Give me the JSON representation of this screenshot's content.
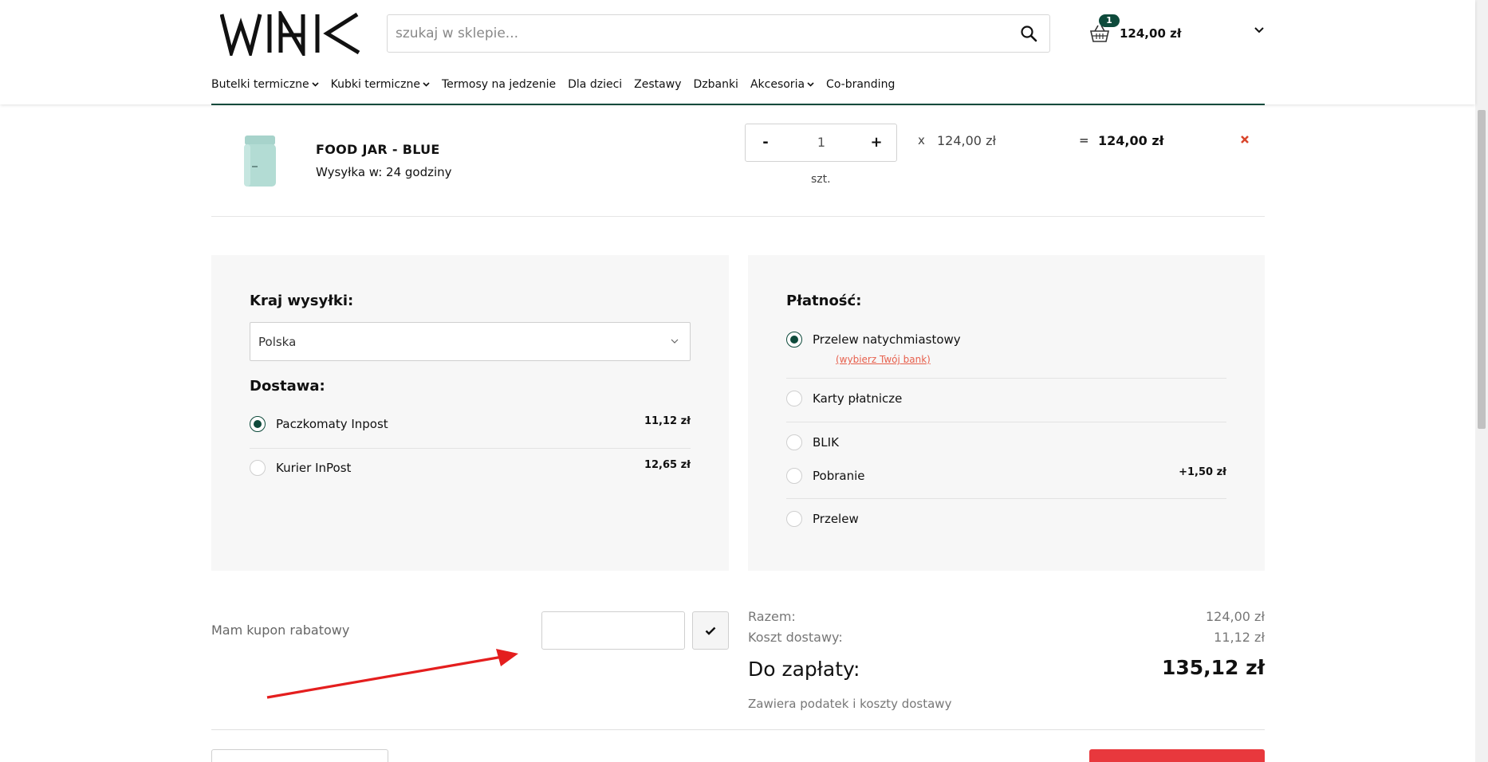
{
  "header": {
    "logo_text": "WINK",
    "search_placeholder": "szukaj w sklepie...",
    "cart_count": "1",
    "cart_total": "124,00 zł"
  },
  "nav": {
    "items": [
      {
        "label": "Butelki termiczne",
        "dropdown": true
      },
      {
        "label": "Kubki termiczne",
        "dropdown": true
      },
      {
        "label": "Termosy na jedzenie",
        "dropdown": false
      },
      {
        "label": "Dla dzieci",
        "dropdown": false
      },
      {
        "label": "Zestawy",
        "dropdown": false
      },
      {
        "label": "Dzbanki",
        "dropdown": false
      },
      {
        "label": "Akcesoria",
        "dropdown": true
      },
      {
        "label": "Co-branding",
        "dropdown": false
      }
    ]
  },
  "product": {
    "name": "FOOD JAR - BLUE",
    "shipping": "Wysyłka w: 24 godziny",
    "qty_minus": "-",
    "qty_value": "1",
    "qty_plus": "+",
    "qty_unit": "szt.",
    "times": "x",
    "unit_price": "124,00 zł",
    "equals": "=",
    "line_total": "124,00 zł"
  },
  "shipping_panel": {
    "country_title": "Kraj wysyłki:",
    "country_value": "Polska",
    "delivery_title": "Dostawa:",
    "options": [
      {
        "label": "Paczkomaty Inpost",
        "price": "11,12 zł",
        "checked": true
      },
      {
        "label": "Kurier InPost",
        "price": "12,65 zł",
        "checked": false
      }
    ]
  },
  "payment_panel": {
    "title": "Płatność:",
    "bank_link": "(wybierz Twój bank)",
    "options": [
      {
        "label": "Przelew natychmiastowy",
        "price": "",
        "checked": true
      },
      {
        "label": "Karty płatnicze",
        "price": "",
        "checked": false
      },
      {
        "label": "BLIK",
        "price": "",
        "checked": false
      },
      {
        "label": "Pobranie",
        "price": "+1,50 zł",
        "checked": false
      },
      {
        "label": "Przelew",
        "price": "",
        "checked": false
      }
    ]
  },
  "coupon": {
    "label": "Mam kupon rabatowy",
    "value": ""
  },
  "summary": {
    "subtotal_label": "Razem:",
    "subtotal_value": "124,00 zł",
    "shipping_label": "Koszt dostawy:",
    "shipping_value": "11,12 zł",
    "pay_label": "Do zapłaty:",
    "pay_value": "135,12 zł",
    "tax_note": "Zawiera podatek i koszty dostawy"
  },
  "colors": {
    "accent": "#0e4a3b",
    "link": "#e7604d",
    "remove": "#d9452b",
    "annotation_arrow": "#e41e1e",
    "order_button": "#e8383d"
  }
}
